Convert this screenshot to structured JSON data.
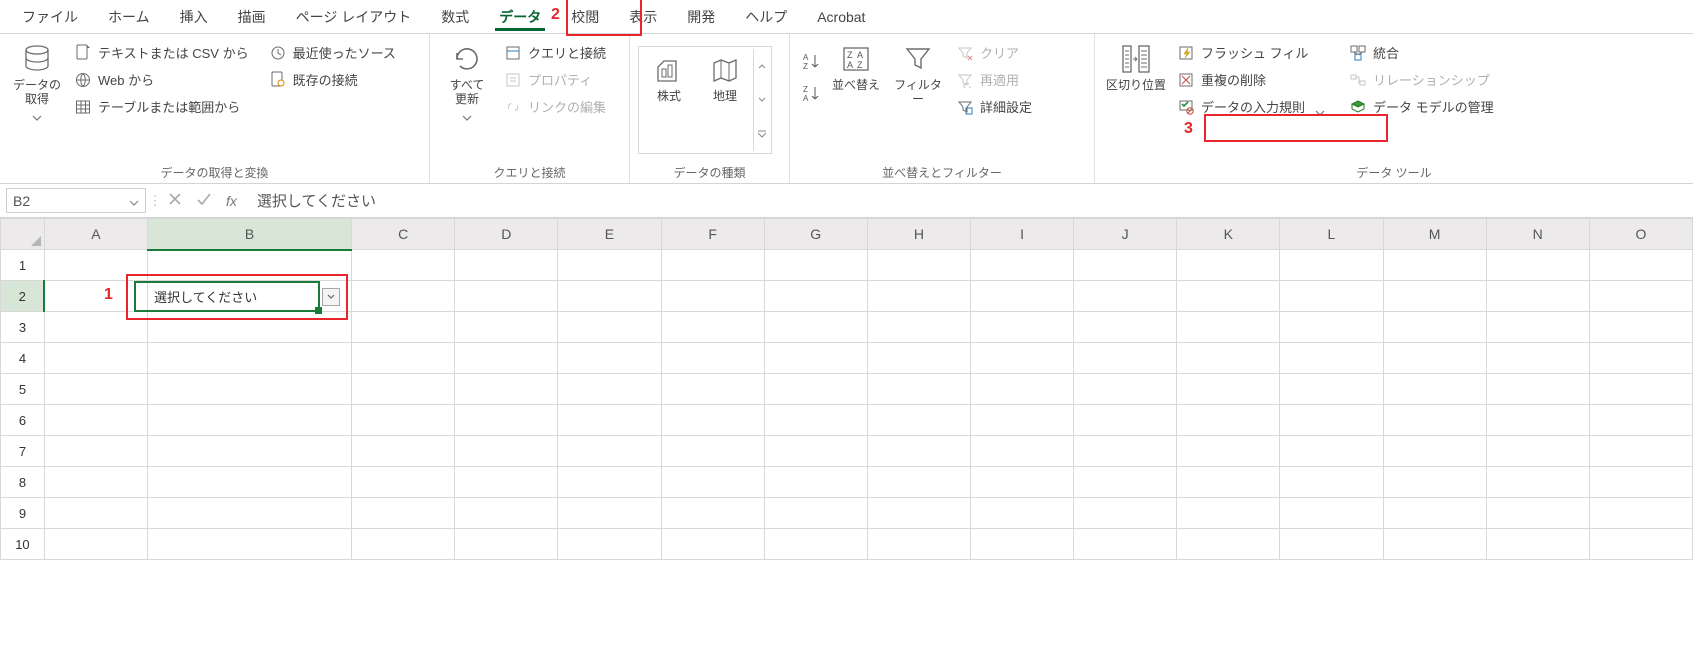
{
  "tabs": {
    "file": "ファイル",
    "home": "ホーム",
    "insert": "挿入",
    "draw": "描画",
    "layout": "ページ レイアウト",
    "formulas": "数式",
    "data": "データ",
    "review": "校閲",
    "view": "表示",
    "developer": "開発",
    "help": "ヘルプ",
    "acrobat": "Acrobat"
  },
  "ribbon": {
    "group1": {
      "label": "データの取得と変換",
      "get_data": "データの\n取得",
      "from_csv": "テキストまたは CSV から",
      "from_web": "Web から",
      "from_table": "テーブルまたは範囲から",
      "recent": "最近使ったソース",
      "existing": "既存の接続"
    },
    "group2": {
      "label": "クエリと接続",
      "refresh": "すべて\n更新",
      "queries": "クエリと接続",
      "properties": "プロパティ",
      "edit_links": "リンクの編集"
    },
    "group3": {
      "label": "データの種類",
      "stocks": "株式",
      "geo": "地理"
    },
    "group4": {
      "label": "並べ替えとフィルター",
      "sort": "並べ替え",
      "filter": "フィルター",
      "clear": "クリア",
      "reapply": "再適用",
      "advanced": "詳細設定"
    },
    "group5": {
      "label": "データ ツール",
      "text_to_col": "区切り位置",
      "flash_fill": "フラッシュ フィル",
      "remove_dup": "重複の削除",
      "data_val": "データの入力規則",
      "consolidate": "統合",
      "relationships": "リレーションシップ",
      "data_model": "データ モデルの管理"
    }
  },
  "formula_bar": {
    "name_box": "B2",
    "content": "選択してください"
  },
  "columns": [
    "A",
    "B",
    "C",
    "D",
    "E",
    "F",
    "G",
    "H",
    "I",
    "J",
    "K",
    "L",
    "M",
    "N",
    "O"
  ],
  "rows": [
    "1",
    "2",
    "3",
    "4",
    "5",
    "6",
    "7",
    "8",
    "9",
    "10"
  ],
  "cell_b2": "選択してください",
  "annotations": {
    "n1": "1",
    "n2": "2",
    "n3": "3"
  }
}
